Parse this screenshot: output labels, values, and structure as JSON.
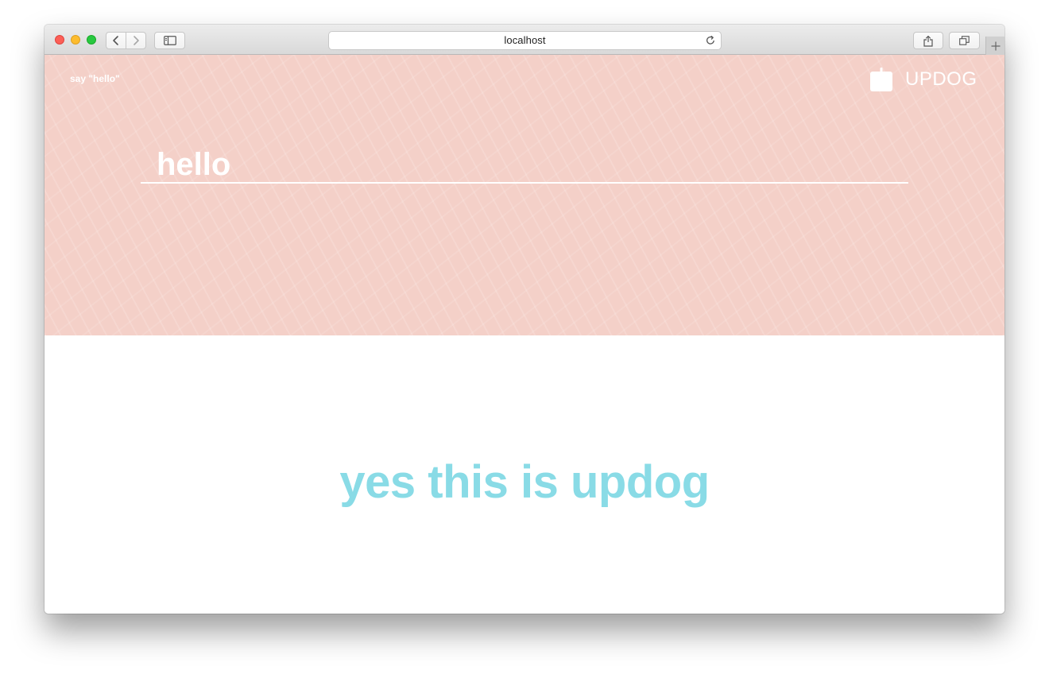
{
  "browser": {
    "url": "localhost"
  },
  "header": {
    "prompt": "say \"hello\"",
    "brand_name": "UPDOG"
  },
  "message": {
    "value": "hello"
  },
  "response": {
    "text": "yes this is updog"
  },
  "colors": {
    "hero_background": "#f4d0c8",
    "response_text": "#89dbe6",
    "hero_text": "#ffffff"
  },
  "icons": {
    "brand": "bag-logo-icon",
    "back": "chevron-left-icon",
    "forward": "chevron-right-icon",
    "sidebar": "sidebar-icon",
    "reload": "reload-icon",
    "share": "share-icon",
    "tabs": "tabs-overview-icon",
    "new_tab": "plus-icon"
  }
}
